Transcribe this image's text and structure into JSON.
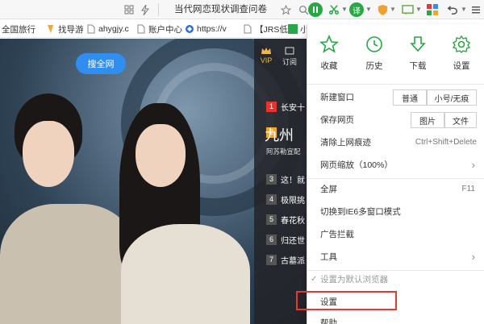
{
  "toolbar": {
    "page_title": "当代网恋现状调查问卷",
    "icons": [
      "grid-icon",
      "flash-icon",
      "star-icon",
      "search-icon",
      "extension-icon",
      "scissors-icon",
      "translate-icon",
      "vpn-icon",
      "message-icon",
      "apps-icon",
      "undo-icon",
      "menu-icon"
    ]
  },
  "bookmarks": [
    {
      "label": "全国旅行",
      "icon": "globe-icon"
    },
    {
      "label": "找导游",
      "icon": "guide-icon"
    },
    {
      "label": "ahygjy.c",
      "icon": "page-icon"
    },
    {
      "label": "账户中心",
      "icon": "account-icon"
    },
    {
      "label": "https://v",
      "icon": "link-icon"
    },
    {
      "label": "【JRS低",
      "icon": "sports-icon"
    },
    {
      "label": "小",
      "icon": "bookmark-icon"
    }
  ],
  "content": {
    "search_button": "搜全网",
    "vip_label": "VIP",
    "subscribe_label": "订阅",
    "featured_title": "九州",
    "featured_subtitle": "阿苏勒宣配",
    "rank_list": [
      {
        "num": "1",
        "title": "长安十"
      },
      {
        "num": "3",
        "title": "这！就"
      },
      {
        "num": "4",
        "title": "极限挑"
      },
      {
        "num": "5",
        "title": "春花秋"
      },
      {
        "num": "6",
        "title": "归还世"
      },
      {
        "num": "7",
        "title": "古墓派"
      }
    ]
  },
  "menu": {
    "top_actions": [
      {
        "label": "收藏",
        "icon": "star-outline-icon"
      },
      {
        "label": "历史",
        "icon": "clock-icon"
      },
      {
        "label": "下载",
        "icon": "download-icon"
      },
      {
        "label": "设置",
        "icon": "gear-icon"
      }
    ],
    "new_window": {
      "label": "新建窗口",
      "normal": "普通",
      "small_incognito": "小号/无痕"
    },
    "save_page": {
      "label": "保存网页",
      "image": "图片",
      "file": "文件"
    },
    "clear_history": {
      "label": "清除上网痕迹",
      "shortcut": "Ctrl+Shift+Delete"
    },
    "zoom": {
      "label": "网页缩放（100%）"
    },
    "fullscreen": {
      "label": "全屏",
      "shortcut": "F11"
    },
    "ie6_mode": {
      "label": "切换到IE6多窗口模式"
    },
    "ad_block": {
      "label": "广告拦截"
    },
    "tools": {
      "label": "工具"
    },
    "default_browser": {
      "label": "设置为默认浏览器"
    },
    "settings": {
      "label": "设置"
    },
    "help": {
      "label": "帮助"
    }
  },
  "colors": {
    "accent_green": "#27a844",
    "highlight_red": "#e53935",
    "search_blue": "#2f8ef0"
  }
}
